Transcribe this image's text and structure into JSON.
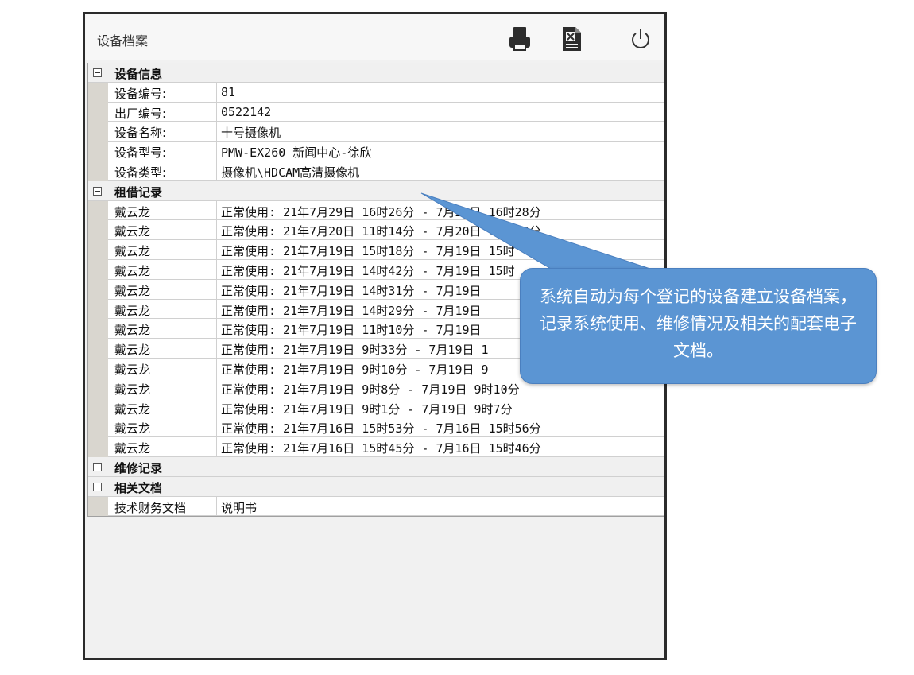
{
  "window": {
    "title": "设备档案",
    "toolbar": {
      "print_icon": "printer-icon",
      "export_icon": "excel-export-icon",
      "close_icon": "power-icon"
    }
  },
  "sections": [
    {
      "title": "设备信息",
      "rows": [
        {
          "label": "设备编号:",
          "value": "81"
        },
        {
          "label": "出厂编号:",
          "value": "0522142"
        },
        {
          "label": "设备名称:",
          "value": "十号摄像机"
        },
        {
          "label": "设备型号:",
          "value": "PMW-EX260 新闻中心-徐欣"
        },
        {
          "label": "设备类型:",
          "value": "摄像机\\HDCAM高清摄像机"
        }
      ]
    },
    {
      "title": "租借记录",
      "rows": [
        {
          "label": "戴云龙",
          "value": "正常使用: 21年7月29日 16时26分 - 7月29日 16时28分"
        },
        {
          "label": "戴云龙",
          "value": "正常使用: 21年7月20日 11时14分 - 7月20日 11时26分"
        },
        {
          "label": "戴云龙",
          "value": "正常使用: 21年7月19日 15时18分 - 7月19日 15时"
        },
        {
          "label": "戴云龙",
          "value": "正常使用: 21年7月19日 14时42分 - 7月19日 15时"
        },
        {
          "label": "戴云龙",
          "value": "正常使用: 21年7月19日 14时31分 - 7月19日"
        },
        {
          "label": "戴云龙",
          "value": "正常使用: 21年7月19日 14时29分 - 7月19日"
        },
        {
          "label": "戴云龙",
          "value": "正常使用: 21年7月19日 11时10分 - 7月19日"
        },
        {
          "label": "戴云龙",
          "value": "正常使用: 21年7月19日 9时33分 - 7月19日 1"
        },
        {
          "label": "戴云龙",
          "value": "正常使用: 21年7月19日 9时10分 - 7月19日 9"
        },
        {
          "label": "戴云龙",
          "value": "正常使用: 21年7月19日 9时8分 - 7月19日 9时10分"
        },
        {
          "label": "戴云龙",
          "value": "正常使用: 21年7月19日 9时1分 - 7月19日 9时7分"
        },
        {
          "label": "戴云龙",
          "value": "正常使用: 21年7月16日 15时53分 - 7月16日 15时56分"
        },
        {
          "label": "戴云龙",
          "value": "正常使用: 21年7月16日 15时45分 - 7月16日 15时46分"
        }
      ]
    },
    {
      "title": "维修记录",
      "rows": []
    },
    {
      "title": "相关文档",
      "rows": [
        {
          "label": "技术财务文档",
          "value": "说明书"
        }
      ]
    }
  ],
  "callout": {
    "text": "系统自动为每个登记的设备建立设备档案，记录系统使用、维修情况及相关的配套电子文档。"
  },
  "colors": {
    "callout_fill": "#5b95d3",
    "window_border": "#2b2b2b",
    "gutter": "#d9d6cf"
  }
}
